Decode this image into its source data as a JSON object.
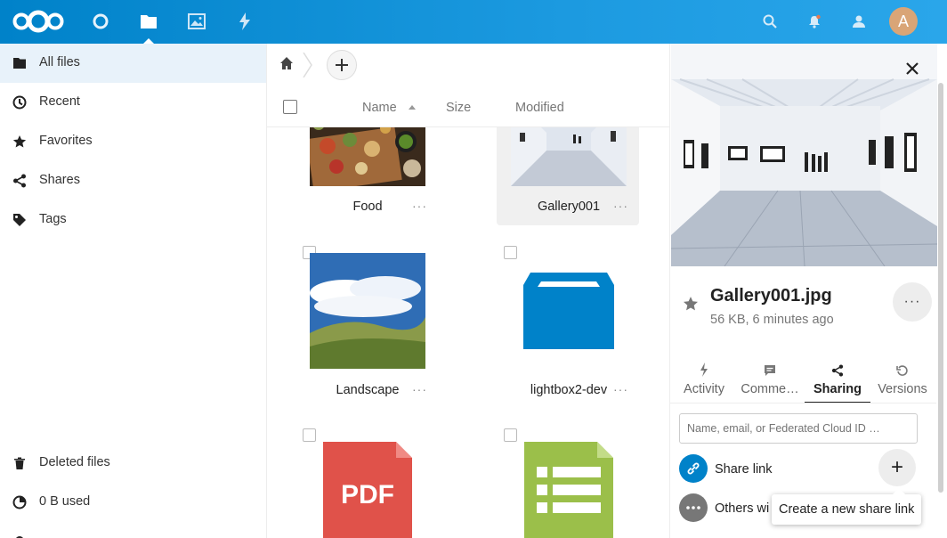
{
  "header": {
    "apps": [
      {
        "name": "logo"
      },
      {
        "name": "dashboard"
      },
      {
        "name": "files"
      },
      {
        "name": "photos"
      },
      {
        "name": "activity"
      }
    ],
    "avatar_initial": "A",
    "colors": {
      "bar": "#0082c9"
    }
  },
  "sidebar": {
    "items": [
      {
        "label": "All files",
        "icon": "folder-icon"
      },
      {
        "label": "Recent",
        "icon": "clock-icon"
      },
      {
        "label": "Favorites",
        "icon": "star-icon"
      },
      {
        "label": "Shares",
        "icon": "share-icon"
      },
      {
        "label": "Tags",
        "icon": "tag-icon"
      }
    ],
    "bottom_items": [
      {
        "label": "Deleted files",
        "icon": "trash-icon"
      },
      {
        "label": "0 B used",
        "icon": "quota-icon"
      }
    ]
  },
  "files": {
    "columns": {
      "name": "Name",
      "size": "Size",
      "modified": "Modified"
    },
    "tiles": [
      {
        "name": "Food",
        "more": "···"
      },
      {
        "name": "Gallery001",
        "more": "···"
      },
      {
        "name": "Landscape",
        "more": "···"
      },
      {
        "name": "lightbox2-dev",
        "more": "···"
      },
      {
        "name": "PDF"
      },
      {
        "name": ""
      }
    ]
  },
  "details": {
    "file_name": "Gallery001.jpg",
    "file_meta": "56 KB, 6 minutes ago",
    "close": "✕",
    "more": "···",
    "tabs": [
      {
        "label": "Activity"
      },
      {
        "label": "Comme…"
      },
      {
        "label": "Sharing"
      },
      {
        "label": "Versions"
      }
    ],
    "share_input_placeholder": "Name, email, or Federated Cloud ID …",
    "share_link_label": "Share link",
    "others_label": "Others wi",
    "add_share": "+",
    "tooltip": "Create a new share link"
  }
}
